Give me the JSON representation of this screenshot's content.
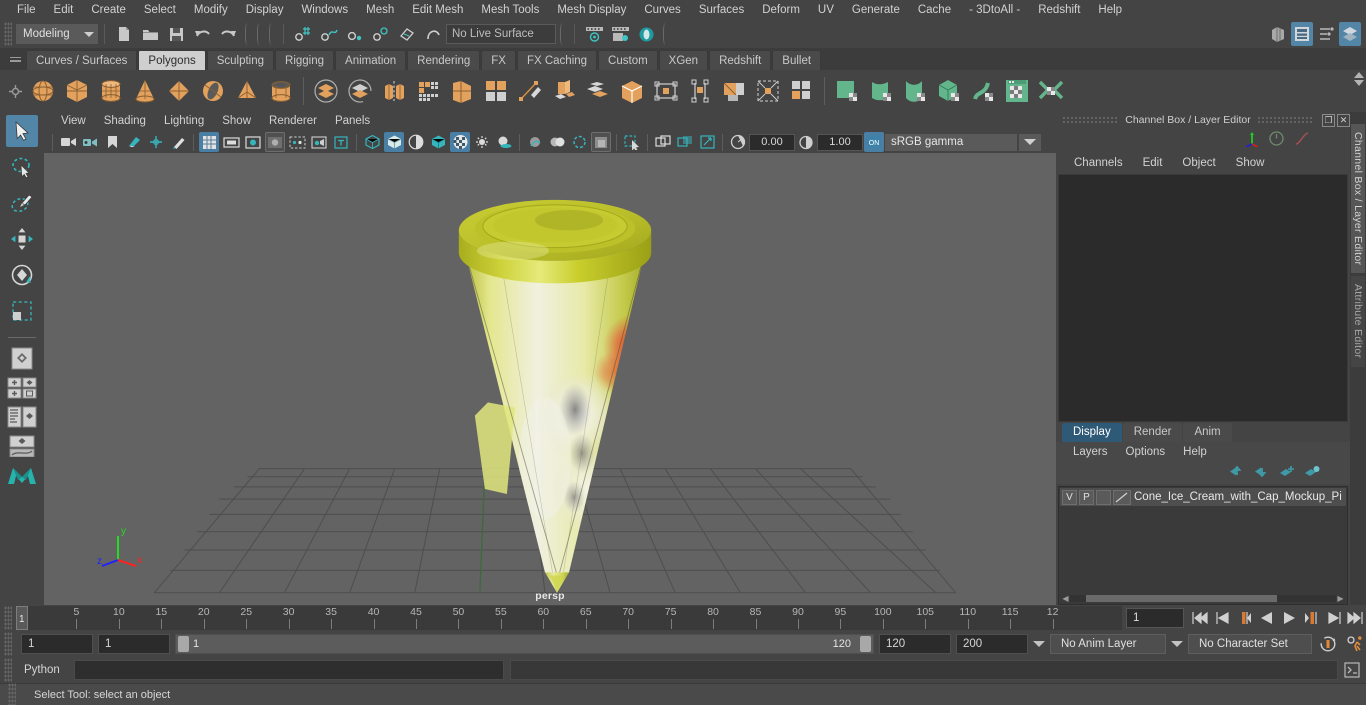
{
  "menubar": {
    "items": [
      "File",
      "Edit",
      "Create",
      "Select",
      "Modify",
      "Display",
      "Windows",
      "Mesh",
      "Edit Mesh",
      "Mesh Tools",
      "Mesh Display",
      "Curves",
      "Surfaces",
      "Deform",
      "UV",
      "Generate",
      "Cache",
      "- 3DtoAll -",
      "Redshift",
      "Help"
    ]
  },
  "statusline": {
    "mode": "Modeling",
    "live_surface": "No Live Surface"
  },
  "shelf": {
    "tabs": [
      "Curves / Surfaces",
      "Polygons",
      "Sculpting",
      "Rigging",
      "Animation",
      "Rendering",
      "FX",
      "FX Caching",
      "Custom",
      "XGen",
      "Redshift",
      "Bullet"
    ],
    "active_tab": "Polygons",
    "primitives": [
      "poly-sphere-icon",
      "poly-cube-icon",
      "poly-cylinder-icon",
      "poly-cone-icon",
      "poly-plane-icon",
      "poly-torus-icon",
      "poly-pyramid-icon",
      "poly-pipe-icon"
    ],
    "ops": [
      "boolean-union-icon",
      "boolean-difference-icon",
      "combine-icon",
      "smooth-icon",
      "extrude-icon",
      "bevel-icon",
      "bridge-icon",
      "multicut-icon",
      "target-weld-icon",
      "quad-draw-icon",
      "mirror-icon",
      "insert-edge-loop-icon",
      "offset-edge-loop-icon",
      "append-polygon-icon",
      "crease-icon"
    ],
    "uv_tools": [
      "uv-planar-icon",
      "uv-cylindrical-icon",
      "uv-spherical-icon",
      "uv-automatic-icon",
      "uv-camera-icon",
      "uv-editor-icon",
      "uv-unfold-icon"
    ]
  },
  "toolbox": {
    "tools": [
      "select-tool-icon",
      "lasso-select-tool-icon",
      "paint-select-tool-icon",
      "move-tool-icon",
      "rotate-tool-icon",
      "scale-tool-icon"
    ],
    "active_tool": "select-tool-icon",
    "layouts": [
      "single-perspective-layout-icon",
      "four-view-layout-icon",
      "outliner-persp-layout-icon",
      "persp-graph-layout-icon",
      "maya-logo-icon"
    ]
  },
  "viewport": {
    "menus": [
      "View",
      "Shading",
      "Lighting",
      "Show",
      "Renderer",
      "Panels"
    ],
    "exposure": "0.00",
    "gamma": "1.00",
    "color_space": "sRGB gamma",
    "camera_label": "persp",
    "axis_labels": {
      "x": "x",
      "y": "y",
      "z": "z"
    },
    "axis_colors": {
      "x": "#ff2020",
      "y": "#22dd22",
      "z": "#2020ff"
    },
    "grid_color": "#4b4b4b",
    "background_color": "#636363",
    "model": {
      "name": "ice-cream-cone-with-cap",
      "cap_color": "#c8cd2e",
      "cone_color": "#d7de6a",
      "label_accent_color": "#e03028"
    }
  },
  "right_panel": {
    "title": "Channel Box / Layer Editor",
    "channel_menus": [
      "Channels",
      "Edit",
      "Object",
      "Show"
    ],
    "layer_tabs": [
      "Display",
      "Render",
      "Anim"
    ],
    "active_layer_tab": "Display",
    "layer_menus": [
      "Layers",
      "Options",
      "Help"
    ],
    "layers": [
      {
        "visibility": "V",
        "playback": "P",
        "type": "",
        "name": "Cone_Ice_Cream_with_Cap_Mockup_Pi"
      }
    ],
    "side_tabs": [
      "Channel Box / Layer Editor",
      "Attribute Editor"
    ]
  },
  "timeline": {
    "tick_labels": [
      "5",
      "10",
      "15",
      "20",
      "25",
      "30",
      "35",
      "40",
      "45",
      "50",
      "55",
      "60",
      "65",
      "70",
      "75",
      "80",
      "85",
      "90",
      "95",
      "100",
      "105",
      "110",
      "115",
      "12"
    ],
    "current_frame_marker": "1",
    "current_frame_field": "1",
    "playback_buttons": [
      "go-to-start-icon",
      "step-back-frame-icon",
      "step-back-key-icon",
      "play-backwards-icon",
      "play-forwards-icon",
      "step-forward-key-icon",
      "step-forward-frame-icon",
      "go-to-end-icon"
    ]
  },
  "range": {
    "anim_start": "1",
    "playback_start": "1",
    "slider_start_label": "1",
    "slider_end_label": "120",
    "playback_end": "120",
    "anim_end": "200",
    "anim_layer": "No Anim Layer",
    "character_set": "No Character Set",
    "buttons": [
      "auto-keyframe-icon",
      "animation-preferences-icon"
    ]
  },
  "command_line": {
    "language": "Python",
    "input_value": "",
    "output_value": ""
  },
  "status_bar": {
    "message": "Select Tool: select an object"
  }
}
